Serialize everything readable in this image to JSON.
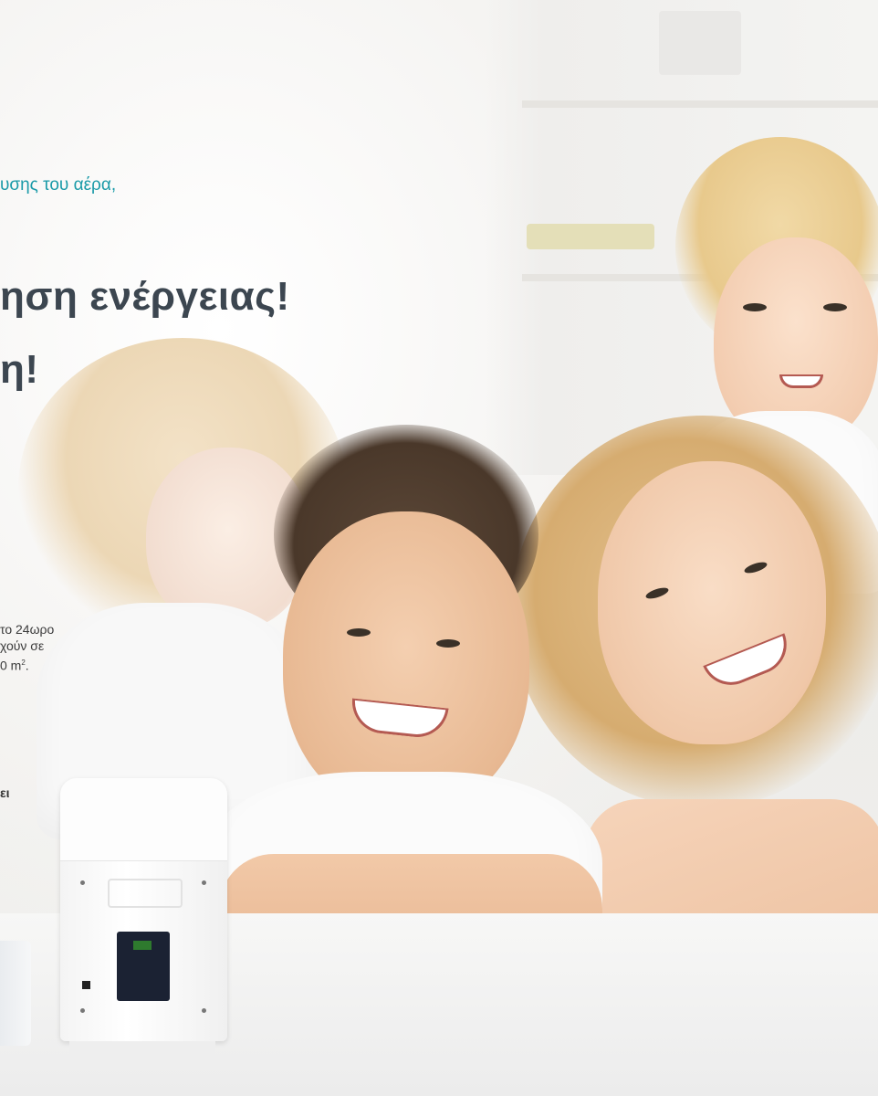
{
  "text": {
    "subtitle": "υσης του αέρα,",
    "headline_line1": "ηση ενέργειας!",
    "headline_line2": "η!",
    "body_line1": "το 24ωρο",
    "body_line2": "χούν σε",
    "body_line3_main": "0 m",
    "body_line3_sup": "2",
    "body_line3_end": ".",
    "fragment_bold": "ει"
  },
  "colors": {
    "subtitle": "#1a9aa8",
    "headline": "#3c4650",
    "body": "#3b3b3b"
  }
}
